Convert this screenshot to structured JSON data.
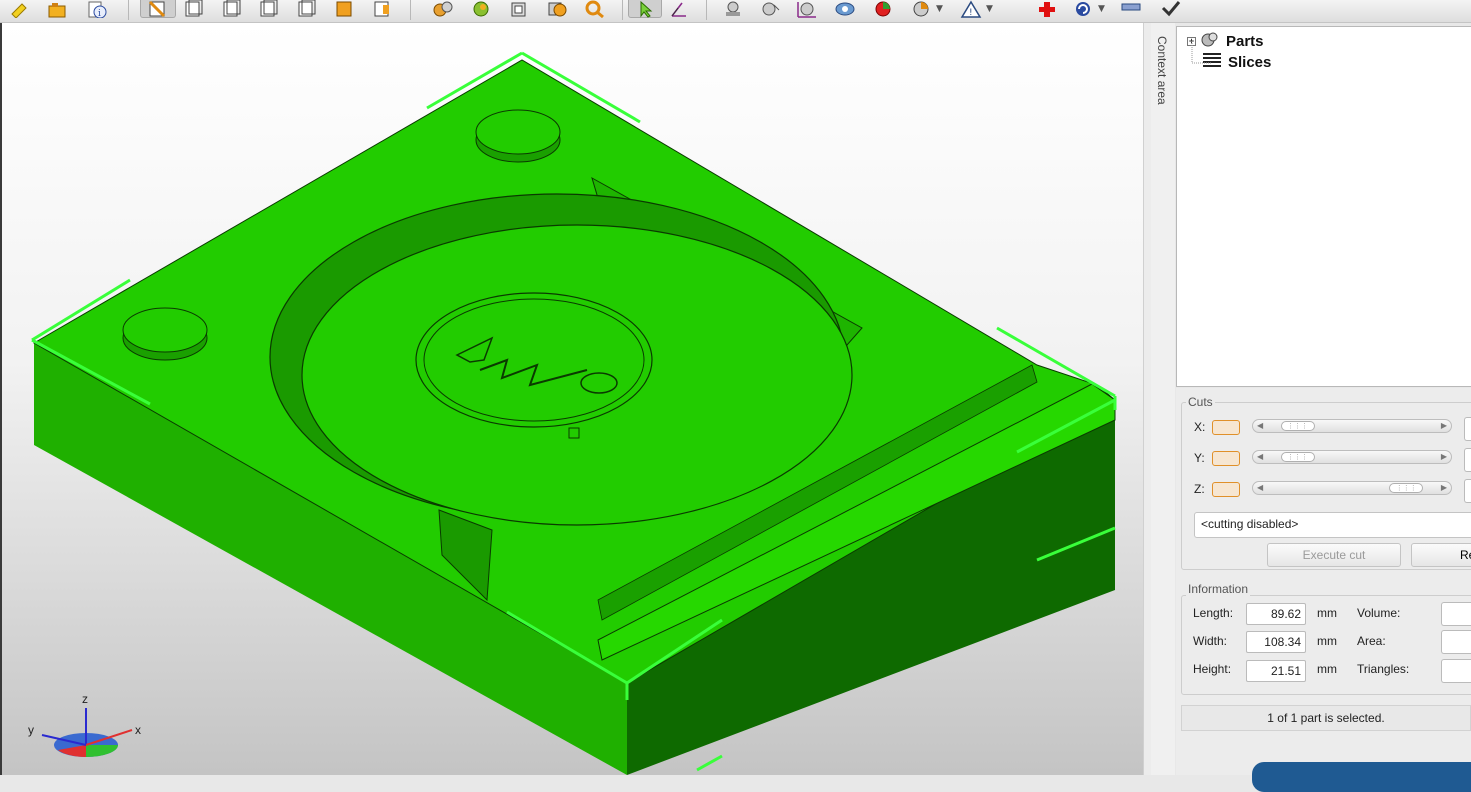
{
  "toolbar": {
    "icons": [
      "new-icon",
      "open-icon",
      "info-icon",
      "view-front-icon",
      "view-back-icon",
      "view-left-icon",
      "view-right-icon",
      "view-top-icon",
      "view-bottom-icon",
      "view-iso-icon",
      "parts-icon",
      "color-icon",
      "cube-icon",
      "paint-icon",
      "search-icon",
      "select-icon",
      "measure-icon",
      "sphere-icon",
      "spheres-icon",
      "transform-icon",
      "globe-icon",
      "material-icon",
      "pie-icon",
      "warning-icon",
      "add-icon",
      "undo-icon",
      "ruler-icon",
      "check-icon"
    ]
  },
  "context_panel": {
    "title": "Context area"
  },
  "tree": {
    "items": [
      {
        "label": "Parts"
      },
      {
        "label": "Slices"
      }
    ]
  },
  "cuts": {
    "title": "Cuts",
    "axes": [
      {
        "label": "X:",
        "position": 0.1
      },
      {
        "label": "Y:",
        "position": 0.1
      },
      {
        "label": "Z:",
        "position": 0.9
      }
    ],
    "mode": "<cutting disabled>",
    "execute_label": "Execute cut",
    "reset_label": "Re"
  },
  "information": {
    "title": "Information",
    "rows": [
      {
        "label": "Length:",
        "value": "89.62",
        "unit": "mm",
        "label2": "Volume:"
      },
      {
        "label": "Width:",
        "value": "108.34",
        "unit": "mm",
        "label2": "Area:"
      },
      {
        "label": "Height:",
        "value": "21.51",
        "unit": "mm",
        "label2": "Triangles:"
      }
    ]
  },
  "status": {
    "text": "1 of 1 part is selected."
  },
  "axes": {
    "x": "x",
    "y": "y",
    "z": "z"
  },
  "colors": {
    "model": "#22cc00",
    "model_dark": "#0e6a00",
    "selection": "#39ff3a"
  }
}
